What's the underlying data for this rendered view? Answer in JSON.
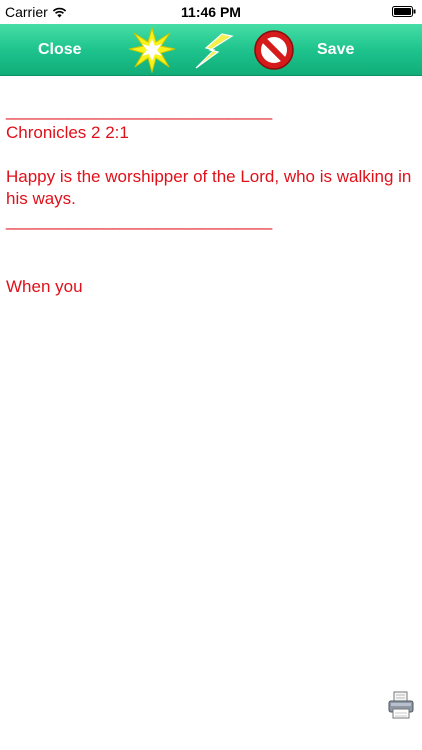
{
  "status_bar": {
    "carrier": "Carrier",
    "time": "11:46 PM"
  },
  "toolbar": {
    "close_label": "Close",
    "save_label": "Save",
    "icons": [
      "starburst-icon",
      "lightning-icon",
      "no-sign-icon"
    ],
    "colors": {
      "bar_top": "#46dea6",
      "bar_bottom": "#10ad79",
      "label": "#ffffff"
    }
  },
  "note": {
    "divider_top": "______________________________",
    "reference": "Chronicles 2 2:1",
    "verse": "Happy is the worshipper of the Lord, who is walking in his ways.",
    "divider_bottom": "______________________________",
    "body": "When you",
    "text_color": "#e0101a"
  },
  "footer": {
    "print_icon": "printer-icon"
  }
}
